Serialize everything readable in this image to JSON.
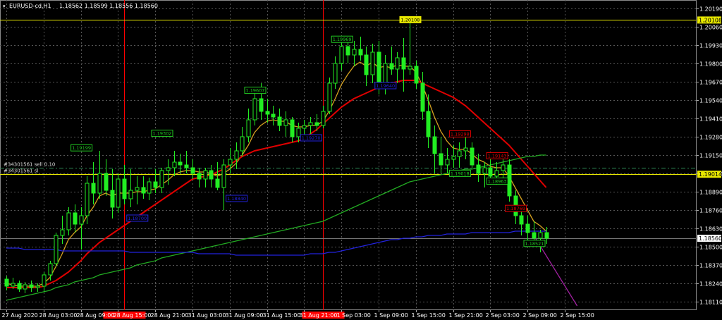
{
  "header": {
    "symbol": "EURUSD-cd,H1",
    "ohlc": "1.18562 1.18599 1.18556 1.18560"
  },
  "order_lines": [
    {
      "label": "#34301561 sell 0.10",
      "price": 1.1906,
      "color": "#2e8b57"
    },
    {
      "label": "#34301561 sl",
      "price": 1.19014,
      "color": "#e8e800"
    }
  ],
  "price_markers": [
    {
      "price": 1.20108,
      "text": "1.20108",
      "color": "#e8e800",
      "text_color": "#000000"
    },
    {
      "price": 1.19014,
      "text": "1.19014",
      "color": "#e8e800",
      "text_color": "#000000"
    },
    {
      "price": 1.1856,
      "text": "1.18560",
      "color": "#ffffff",
      "text_color": "#000000"
    }
  ],
  "time_markers": [
    {
      "x": 19,
      "text": "",
      "color": "#ff0000"
    },
    {
      "x": 51,
      "text": "",
      "color": "#ff0000"
    }
  ],
  "chart_data": {
    "type": "line",
    "title": "EURUSD-cd,H1",
    "xlabel": "",
    "ylabel": "",
    "ylim": [
      1.1805,
      1.2025
    ],
    "grid": true,
    "x_ticks": [
      {
        "i": 0,
        "label": "27 Aug 2020"
      },
      {
        "i": 6,
        "label": "28 Aug 03:00"
      },
      {
        "i": 12,
        "label": "28 Aug 09:00"
      },
      {
        "i": 18,
        "label": "28 Aug 15:00"
      },
      {
        "i": 24,
        "label": "28 Aug 21:00"
      },
      {
        "i": 30,
        "label": "31 Aug 03:00"
      },
      {
        "i": 36,
        "label": "31 Aug 09:00"
      },
      {
        "i": 42,
        "label": "31 Aug 15:00"
      },
      {
        "i": 48,
        "label": "31 Aug 21:00"
      },
      {
        "i": 54,
        "label": "1 Sep 03:00"
      },
      {
        "i": 60,
        "label": "1 Sep 09:00"
      },
      {
        "i": 66,
        "label": "1 Sep 15:00"
      },
      {
        "i": 72,
        "label": "1 Sep 21:00"
      },
      {
        "i": 78,
        "label": "2 Sep 03:00"
      },
      {
        "i": 84,
        "label": "2 Sep 09:00"
      },
      {
        "i": 90,
        "label": "2 Sep 15:00"
      }
    ],
    "y_ticks": [
      1.2019,
      1.2006,
      1.1993,
      1.198,
      1.1967,
      1.1954,
      1.1941,
      1.1928,
      1.1915,
      1.1902,
      1.1889,
      1.1876,
      1.1863,
      1.185,
      1.1837,
      1.1824,
      1.1811
    ],
    "candles": [
      [
        1.1827,
        1.1829,
        1.1819,
        1.1822
      ],
      [
        1.1822,
        1.1828,
        1.182,
        1.1824
      ],
      [
        1.1824,
        1.1826,
        1.1818,
        1.182
      ],
      [
        1.182,
        1.1825,
        1.1817,
        1.1823
      ],
      [
        1.1823,
        1.1826,
        1.1818,
        1.1821
      ],
      [
        1.1821,
        1.1824,
        1.1818,
        1.1822
      ],
      [
        1.1822,
        1.1832,
        1.1818,
        1.183
      ],
      [
        1.183,
        1.184,
        1.1826,
        1.1838
      ],
      [
        1.1838,
        1.186,
        1.1836,
        1.1858
      ],
      [
        1.1858,
        1.1872,
        1.1852,
        1.1862
      ],
      [
        1.1862,
        1.1878,
        1.1858,
        1.1874
      ],
      [
        1.1874,
        1.188,
        1.186,
        1.1866
      ],
      [
        1.1866,
        1.1878,
        1.1848,
        1.1872
      ],
      [
        1.1872,
        1.19,
        1.1866,
        1.1895
      ],
      [
        1.1895,
        1.191,
        1.188,
        1.1888
      ],
      [
        1.1888,
        1.1918,
        1.1884,
        1.1902
      ],
      [
        1.1902,
        1.1912,
        1.1886,
        1.189
      ],
      [
        1.189,
        1.1905,
        1.187,
        1.1878
      ],
      [
        1.1878,
        1.1902,
        1.1874,
        1.1898
      ],
      [
        1.1898,
        1.1908,
        1.188,
        1.1884
      ],
      [
        1.1884,
        1.1905,
        1.1878,
        1.189
      ],
      [
        1.189,
        1.19,
        1.188,
        1.1892
      ],
      [
        1.1892,
        1.19,
        1.1884,
        1.1888
      ],
      [
        1.1888,
        1.1899,
        1.1883,
        1.1896
      ],
      [
        1.1896,
        1.1905,
        1.1888,
        1.1892
      ],
      [
        1.1892,
        1.1906,
        1.1888,
        1.1904
      ],
      [
        1.1904,
        1.1912,
        1.1894,
        1.1906
      ],
      [
        1.1906,
        1.1918,
        1.19,
        1.191
      ],
      [
        1.191,
        1.1916,
        1.1902,
        1.1908
      ],
      [
        1.1908,
        1.1918,
        1.1902,
        1.1906
      ],
      [
        1.1906,
        1.1912,
        1.1898,
        1.1902
      ],
      [
        1.1902,
        1.1906,
        1.1892,
        1.1898
      ],
      [
        1.1898,
        1.1906,
        1.1892,
        1.1904
      ],
      [
        1.1904,
        1.1908,
        1.1892,
        1.1898
      ],
      [
        1.1898,
        1.191,
        1.189,
        1.1892
      ],
      [
        1.1892,
        1.1912,
        1.1876,
        1.1908
      ],
      [
        1.1908,
        1.192,
        1.1902,
        1.1912
      ],
      [
        1.1912,
        1.1924,
        1.1905,
        1.1918
      ],
      [
        1.1918,
        1.1935,
        1.1914,
        1.1928
      ],
      [
        1.1928,
        1.1948,
        1.1924,
        1.194
      ],
      [
        1.194,
        1.1962,
        1.1936,
        1.1955
      ],
      [
        1.1955,
        1.1966,
        1.194,
        1.1946
      ],
      [
        1.1946,
        1.1955,
        1.1938,
        1.1944
      ],
      [
        1.1944,
        1.195,
        1.1936,
        1.1942
      ],
      [
        1.1942,
        1.1948,
        1.1932,
        1.1936
      ],
      [
        1.1936,
        1.1946,
        1.1928,
        1.194
      ],
      [
        1.194,
        1.1942,
        1.1924,
        1.1928
      ],
      [
        1.1928,
        1.1938,
        1.1924,
        1.1934
      ],
      [
        1.1934,
        1.194,
        1.1928,
        1.1936
      ],
      [
        1.1936,
        1.1942,
        1.193,
        1.1938
      ],
      [
        1.1938,
        1.1944,
        1.1932,
        1.1936
      ],
      [
        1.1936,
        1.195,
        1.1934,
        1.1946
      ],
      [
        1.1946,
        1.197,
        1.1944,
        1.1966
      ],
      [
        1.1966,
        1.1985,
        1.1962,
        1.198
      ],
      [
        1.198,
        1.1996,
        1.1975,
        1.1992
      ],
      [
        1.1992,
        1.1998,
        1.198,
        1.1986
      ],
      [
        1.1986,
        1.1996,
        1.1978,
        1.199
      ],
      [
        1.199,
        1.1999,
        1.1982,
        1.1986
      ],
      [
        1.1986,
        1.1992,
        1.1964,
        1.1972
      ],
      [
        1.1972,
        1.1994,
        1.1966,
        1.1988
      ],
      [
        1.1988,
        1.1996,
        1.1958,
        1.1964
      ],
      [
        1.1964,
        1.1986,
        1.1958,
        1.198
      ],
      [
        1.198,
        1.1992,
        1.1972,
        1.1976
      ],
      [
        1.1976,
        1.1988,
        1.1966,
        1.1984
      ],
      [
        1.1984,
        1.1998,
        1.196,
        1.1976
      ],
      [
        1.1976,
        1.2011,
        1.1972,
        1.1978
      ],
      [
        1.1978,
        1.1982,
        1.1962,
        1.1966
      ],
      [
        1.1966,
        1.1974,
        1.194,
        1.1946
      ],
      [
        1.1946,
        1.1958,
        1.192,
        1.1928
      ],
      [
        1.1928,
        1.1936,
        1.1902,
        1.1916
      ],
      [
        1.1916,
        1.1928,
        1.1902,
        1.1908
      ],
      [
        1.1908,
        1.192,
        1.1902,
        1.1912
      ],
      [
        1.1912,
        1.1922,
        1.1906,
        1.1914
      ],
      [
        1.1914,
        1.1924,
        1.1906,
        1.1918
      ],
      [
        1.1918,
        1.193,
        1.1912,
        1.192
      ],
      [
        1.192,
        1.1924,
        1.1906,
        1.1908
      ],
      [
        1.1908,
        1.1916,
        1.1896,
        1.1902
      ],
      [
        1.1902,
        1.191,
        1.1892,
        1.1906
      ],
      [
        1.1906,
        1.1912,
        1.1898,
        1.19
      ],
      [
        1.19,
        1.191,
        1.1894,
        1.1904
      ],
      [
        1.1904,
        1.1912,
        1.1896,
        1.1908
      ],
      [
        1.1908,
        1.1912,
        1.1882,
        1.1886
      ],
      [
        1.1886,
        1.189,
        1.1866,
        1.1872
      ],
      [
        1.1872,
        1.1878,
        1.1858,
        1.1866
      ],
      [
        1.1866,
        1.1872,
        1.1852,
        1.186
      ],
      [
        1.186,
        1.1868,
        1.1852,
        1.1856
      ],
      [
        1.1856,
        1.1862,
        1.1846,
        1.186
      ],
      [
        1.186,
        1.1864,
        1.1852,
        1.1856
      ]
    ],
    "series": [
      {
        "color": "#d4a020",
        "values": [
          1.1824,
          1.1823,
          1.1822,
          1.1822,
          1.1822,
          1.1822,
          1.1824,
          1.1828,
          1.1836,
          1.1845,
          1.1855,
          1.186,
          1.1864,
          1.1872,
          1.1878,
          1.1886,
          1.1888,
          1.1886,
          1.1888,
          1.1888,
          1.1888,
          1.1889,
          1.1889,
          1.189,
          1.1891,
          1.1894,
          1.1897,
          1.1901,
          1.1903,
          1.1904,
          1.1904,
          1.1903,
          1.1903,
          1.1902,
          1.19,
          1.1902,
          1.1905,
          1.1909,
          1.1915,
          1.1922,
          1.1931,
          1.1936,
          1.1939,
          1.194,
          1.1939,
          1.1939,
          1.1936,
          1.1935,
          1.1935,
          1.1936,
          1.1936,
          1.1939,
          1.1946,
          1.1955,
          1.1965,
          1.1972,
          1.1978,
          1.1981,
          1.1978,
          1.1981,
          1.1977,
          1.1978,
          1.1977,
          1.1979,
          1.1978,
          1.1978,
          1.1974,
          1.1965,
          1.1954,
          1.1942,
          1.1932,
          1.1925,
          1.192,
          1.1919,
          1.1919,
          1.1916,
          1.1912,
          1.191,
          1.1907,
          1.1906,
          1.1906,
          1.19,
          1.1892,
          1.1884,
          1.1876,
          1.1868,
          1.1865,
          1.1861
        ]
      },
      {
        "color": "#e00000",
        "values": [
          1.1821,
          1.1821,
          1.1821,
          1.1821,
          1.1821,
          1.1821,
          1.1822,
          1.1824,
          1.1826,
          1.1829,
          1.1832,
          1.1836,
          1.184,
          1.1845,
          1.1849,
          1.1853,
          1.1856,
          1.1859,
          1.1862,
          1.1865,
          1.1868,
          1.1871,
          1.1874,
          1.1877,
          1.188,
          1.1883,
          1.1886,
          1.1889,
          1.1892,
          1.1895,
          1.1898,
          1.1899,
          1.19,
          1.1901,
          1.1903,
          1.1905,
          1.1908,
          1.1911,
          1.1914,
          1.1916,
          1.1918,
          1.1919,
          1.192,
          1.1921,
          1.1922,
          1.1923,
          1.1924,
          1.1925,
          1.1927,
          1.193,
          1.1933,
          1.1937,
          1.1941,
          1.1945,
          1.1949,
          1.1952,
          1.1955,
          1.1957,
          1.1959,
          1.1961,
          1.1963,
          1.1965,
          1.1966,
          1.1967,
          1.1968,
          1.1968,
          1.1968,
          1.1966,
          1.1964,
          1.1962,
          1.196,
          1.1958,
          1.1956,
          1.1953,
          1.195,
          1.1946,
          1.1942,
          1.1938,
          1.1934,
          1.193,
          1.1926,
          1.1922,
          1.1917,
          1.1912,
          1.1907,
          1.1902,
          1.1897,
          1.1892
        ]
      },
      {
        "color": "#22aa22",
        "values": [
          1.1812,
          1.1813,
          1.1814,
          1.1815,
          1.1816,
          1.1817,
          1.1818,
          1.1819,
          1.1821,
          1.1822,
          1.1823,
          1.1825,
          1.1826,
          1.1827,
          1.1828,
          1.183,
          1.1831,
          1.1832,
          1.1833,
          1.1834,
          1.1835,
          1.1837,
          1.1838,
          1.1839,
          1.184,
          1.1842,
          1.1843,
          1.1844,
          1.1845,
          1.1846,
          1.1847,
          1.1848,
          1.1849,
          1.185,
          1.1851,
          1.1852,
          1.1853,
          1.1854,
          1.1855,
          1.1856,
          1.1857,
          1.1858,
          1.1859,
          1.186,
          1.1861,
          1.1862,
          1.1863,
          1.1864,
          1.1865,
          1.1866,
          1.1867,
          1.1868,
          1.187,
          1.1872,
          1.1874,
          1.1876,
          1.1878,
          1.188,
          1.1882,
          1.1884,
          1.1886,
          1.1888,
          1.189,
          1.1892,
          1.1894,
          1.1896,
          1.1897,
          1.1898,
          1.1899,
          1.19,
          1.1901,
          1.1902,
          1.1903,
          1.1904,
          1.1905,
          1.1905,
          1.1906,
          1.1907,
          1.1908,
          1.1909,
          1.191,
          1.1911,
          1.1912,
          1.1913,
          1.1914,
          1.1914,
          1.1915,
          1.1915
        ]
      },
      {
        "color": "#2222dd",
        "values": [
          1.1849,
          1.1849,
          1.1849,
          1.1848,
          1.1848,
          1.1848,
          1.1848,
          1.1848,
          1.1848,
          1.1847,
          1.1847,
          1.1847,
          1.1847,
          1.1847,
          1.1847,
          1.1847,
          1.1847,
          1.1847,
          1.1847,
          1.1847,
          1.1846,
          1.1846,
          1.1846,
          1.1846,
          1.1846,
          1.1846,
          1.1846,
          1.1846,
          1.1846,
          1.1846,
          1.1846,
          1.1845,
          1.1845,
          1.1845,
          1.1845,
          1.1845,
          1.1845,
          1.1844,
          1.1844,
          1.1844,
          1.1844,
          1.1844,
          1.1844,
          1.1844,
          1.1844,
          1.1844,
          1.1844,
          1.1844,
          1.1844,
          1.1845,
          1.1845,
          1.1845,
          1.1846,
          1.1846,
          1.1847,
          1.1848,
          1.1849,
          1.185,
          1.1851,
          1.1852,
          1.1853,
          1.1854,
          1.1855,
          1.1855,
          1.1856,
          1.1856,
          1.1857,
          1.1857,
          1.1858,
          1.1858,
          1.1858,
          1.1859,
          1.1859,
          1.1859,
          1.1859,
          1.186,
          1.186,
          1.186,
          1.186,
          1.186,
          1.186,
          1.186,
          1.1861,
          1.1861,
          1.1861,
          1.1861,
          1.1861,
          1.1861
        ]
      }
    ],
    "projection": {
      "color": "#a020a0",
      "from": [
        85,
        1.1858
      ],
      "to": [
        92,
        1.1808
      ]
    },
    "labels": [
      {
        "i": 12,
        "price": 1.19199,
        "text": "1.19199",
        "color": "#22cc22"
      },
      {
        "i": 25,
        "price": 1.19302,
        "text": "1.19302",
        "color": "#22cc22"
      },
      {
        "i": 40,
        "price": 1.19607,
        "text": "1.19607",
        "color": "#22cc22"
      },
      {
        "i": 54,
        "price": 1.19969,
        "text": "1.19969",
        "color": "#22cc22"
      },
      {
        "i": 65,
        "price": 1.20108,
        "text": "1.20108",
        "color": "#e8e800"
      },
      {
        "i": 73,
        "price": 1.19298,
        "text": "1.19298",
        "color": "#e00000"
      },
      {
        "i": 79,
        "price": 1.19143,
        "text": "1.19143",
        "color": "#e00000"
      },
      {
        "i": 82,
        "price": 1.18769,
        "text": "1.18769",
        "color": "#e00000"
      },
      {
        "i": 21,
        "price": 1.187,
        "text": "1.18700",
        "color": "#2222dd"
      },
      {
        "i": 37,
        "price": 1.1884,
        "text": "1.18840",
        "color": "#2222dd"
      },
      {
        "i": 49,
        "price": 1.1927,
        "text": "1.19270",
        "color": "#2222dd"
      },
      {
        "i": 61,
        "price": 1.1964,
        "text": "1.19640",
        "color": "#2222dd"
      },
      {
        "i": 73,
        "price": 1.19018,
        "text": "1.19018",
        "color": "#22cc22"
      },
      {
        "i": 79,
        "price": 1.18963,
        "text": "1.18963",
        "color": "#22cc22"
      },
      {
        "i": 85,
        "price": 1.18521,
        "text": "1.18521",
        "color": "#22cc22"
      }
    ]
  }
}
